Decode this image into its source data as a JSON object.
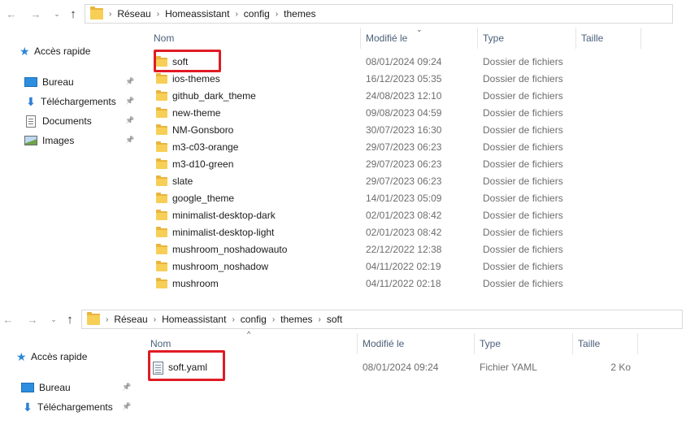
{
  "colors": {
    "highlight": "#e01b24",
    "folder": "#f7cf57",
    "header_text": "#4c607a",
    "accent": "#2b87d6"
  },
  "window1": {
    "nav": {
      "back_icon": "arrow-left-icon",
      "forward_icon": "arrow-right-icon",
      "recent_icon": "chevron-down-icon",
      "up_icon": "arrow-up-icon"
    },
    "breadcrumbs": [
      "Réseau",
      "Homeassistant",
      "config",
      "themes"
    ],
    "sidebar": [
      {
        "label": "Accès rapide",
        "icon": "star-icon"
      },
      {
        "label": "Bureau",
        "icon": "desktop-icon",
        "pinned": true
      },
      {
        "label": "Téléchargements",
        "icon": "download-icon",
        "pinned": true
      },
      {
        "label": "Documents",
        "icon": "documents-icon",
        "pinned": true
      },
      {
        "label": "Images",
        "icon": "images-icon",
        "pinned": true
      }
    ],
    "columns": {
      "name": "Nom",
      "date": "Modifié le",
      "type": "Type",
      "size": "Taille"
    },
    "sort_indicator": "⌄",
    "files": [
      {
        "name": "soft",
        "date": "08/01/2024 09:24",
        "type": "Dossier de fichiers",
        "highlighted": true
      },
      {
        "name": "ios-themes",
        "date": "16/12/2023 05:35",
        "type": "Dossier de fichiers"
      },
      {
        "name": "github_dark_theme",
        "date": "24/08/2023 12:10",
        "type": "Dossier de fichiers"
      },
      {
        "name": "new-theme",
        "date": "09/08/2023 04:59",
        "type": "Dossier de fichiers"
      },
      {
        "name": "NM-Gonsboro",
        "date": "30/07/2023 16:30",
        "type": "Dossier de fichiers"
      },
      {
        "name": "m3-c03-orange",
        "date": "29/07/2023 06:23",
        "type": "Dossier de fichiers"
      },
      {
        "name": "m3-d10-green",
        "date": "29/07/2023 06:23",
        "type": "Dossier de fichiers"
      },
      {
        "name": "slate",
        "date": "29/07/2023 06:23",
        "type": "Dossier de fichiers"
      },
      {
        "name": "google_theme",
        "date": "14/01/2023 05:09",
        "type": "Dossier de fichiers"
      },
      {
        "name": "minimalist-desktop-dark",
        "date": "02/01/2023 08:42",
        "type": "Dossier de fichiers"
      },
      {
        "name": "minimalist-desktop-light",
        "date": "02/01/2023 08:42",
        "type": "Dossier de fichiers"
      },
      {
        "name": "mushroom_noshadowauto",
        "date": "22/12/2022 12:38",
        "type": "Dossier de fichiers"
      },
      {
        "name": "mushroom_noshadow",
        "date": "04/11/2022 02:19",
        "type": "Dossier de fichiers"
      },
      {
        "name": "mushroom",
        "date": "04/11/2022 02:18",
        "type": "Dossier de fichiers"
      }
    ]
  },
  "window2": {
    "breadcrumbs": [
      "Réseau",
      "Homeassistant",
      "config",
      "themes",
      "soft"
    ],
    "sidebar": [
      {
        "label": "Accès rapide",
        "icon": "star-icon"
      },
      {
        "label": "Bureau",
        "icon": "desktop-icon",
        "pinned": true
      },
      {
        "label": "Téléchargements",
        "icon": "download-icon",
        "pinned": true
      }
    ],
    "columns": {
      "name": "Nom",
      "date": "Modifié le",
      "type": "Type",
      "size": "Taille"
    },
    "sort_indicator": "^",
    "files": [
      {
        "name": "soft.yaml",
        "date": "08/01/2024 09:24",
        "type": "Fichier YAML",
        "size": "2 Ko",
        "highlighted": true
      }
    ]
  }
}
